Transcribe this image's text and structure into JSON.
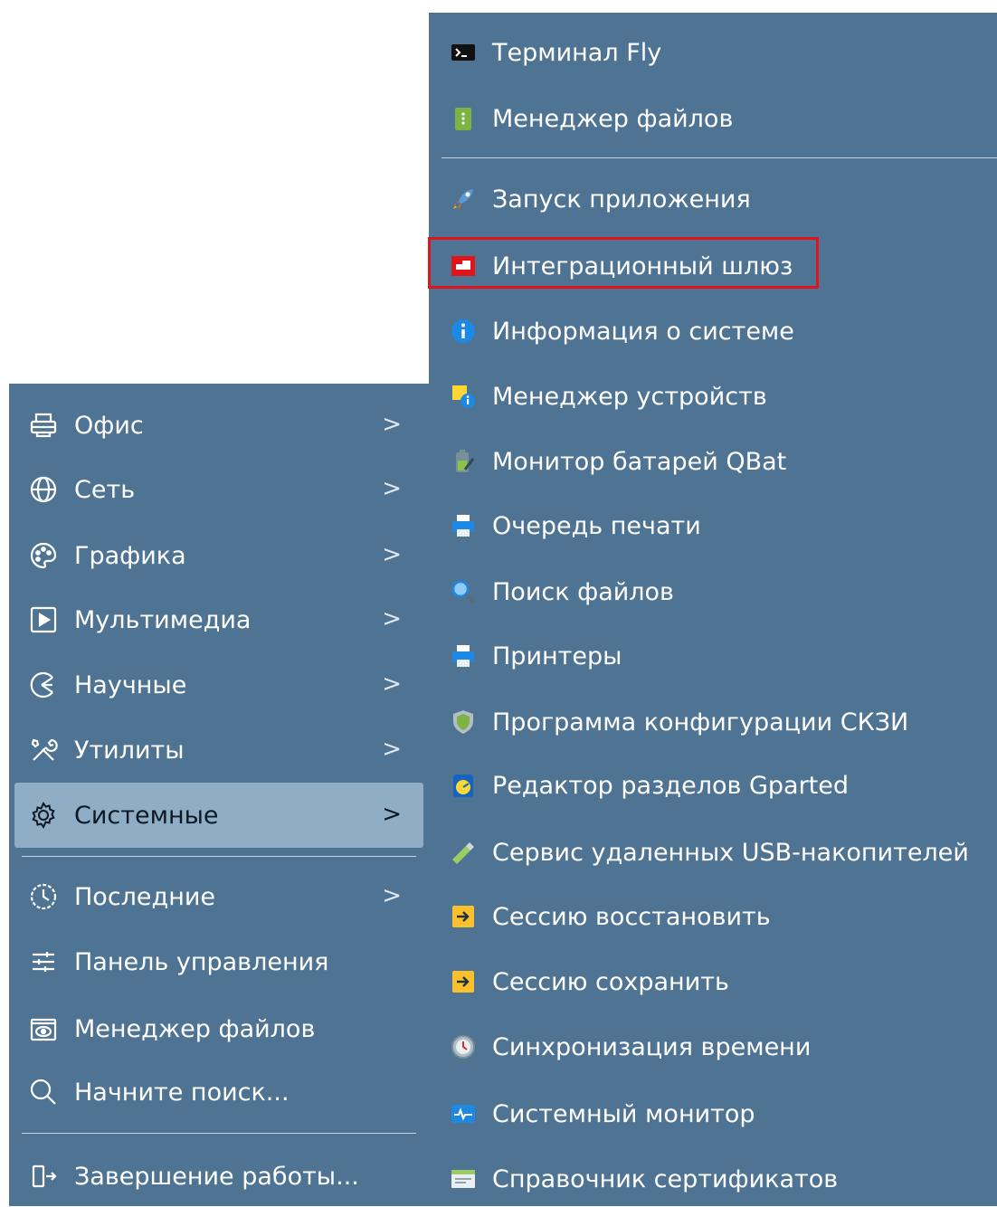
{
  "left_menu": {
    "items": [
      {
        "label": "Офис",
        "icon": "printer-icon",
        "has_submenu": true
      },
      {
        "label": "Сеть",
        "icon": "globe-icon",
        "has_submenu": true
      },
      {
        "label": "Графика",
        "icon": "palette-icon",
        "has_submenu": true
      },
      {
        "label": "Мультимедиа",
        "icon": "play-icon",
        "has_submenu": true
      },
      {
        "label": "Научные",
        "icon": "science-icon",
        "has_submenu": true
      },
      {
        "label": "Утилиты",
        "icon": "tools-icon",
        "has_submenu": true
      },
      {
        "label": "Системные",
        "icon": "gear-icon",
        "has_submenu": true,
        "active": true
      },
      {
        "label": "Последние",
        "icon": "recent-icon",
        "has_submenu": true
      },
      {
        "label": "Панель управления",
        "icon": "sliders-icon",
        "has_submenu": false
      },
      {
        "label": "Менеджер файлов",
        "icon": "folder-eye-icon",
        "has_submenu": false
      },
      {
        "label": "Начните поиск...",
        "icon": "search-icon",
        "has_submenu": false
      },
      {
        "label": "Завершение работы...",
        "icon": "logout-icon",
        "has_submenu": false
      }
    ],
    "arrow_glyph": ">"
  },
  "submenu": {
    "items": [
      {
        "label": "Терминал Fly",
        "icon": "terminal-icon"
      },
      {
        "label": "Менеджер файлов",
        "icon": "file-manager-icon"
      },
      {
        "label": "Запуск приложения",
        "icon": "rocket-icon"
      },
      {
        "label": "Интеграционный шлюз",
        "icon": "gateway-icon",
        "highlighted": true
      },
      {
        "label": "Информация о системе",
        "icon": "info-icon"
      },
      {
        "label": "Менеджер устройств",
        "icon": "device-manager-icon"
      },
      {
        "label": "Монитор батарей QBat",
        "icon": "battery-icon"
      },
      {
        "label": "Очередь печати",
        "icon": "print-queue-icon"
      },
      {
        "label": "Поиск файлов",
        "icon": "magnifier-icon"
      },
      {
        "label": "Принтеры",
        "icon": "printer-color-icon"
      },
      {
        "label": "Программа конфигурации СКЗИ",
        "icon": "shield-icon"
      },
      {
        "label": "Редактор разделов Gparted",
        "icon": "gparted-icon"
      },
      {
        "label": "Сервис удаленных USB-накопителей",
        "icon": "usb-icon"
      },
      {
        "label": "Сессию восстановить",
        "icon": "session-restore-icon"
      },
      {
        "label": "Сессию сохранить",
        "icon": "session-save-icon"
      },
      {
        "label": "Синхронизация времени",
        "icon": "clock-sync-icon"
      },
      {
        "label": "Системный монитор",
        "icon": "system-monitor-icon"
      },
      {
        "label": "Справочник сертификатов",
        "icon": "certificate-icon"
      }
    ]
  },
  "colors": {
    "menu_bg": "#4f7392",
    "active_bg": "#8fadc5",
    "highlight_border": "#e3131a"
  }
}
